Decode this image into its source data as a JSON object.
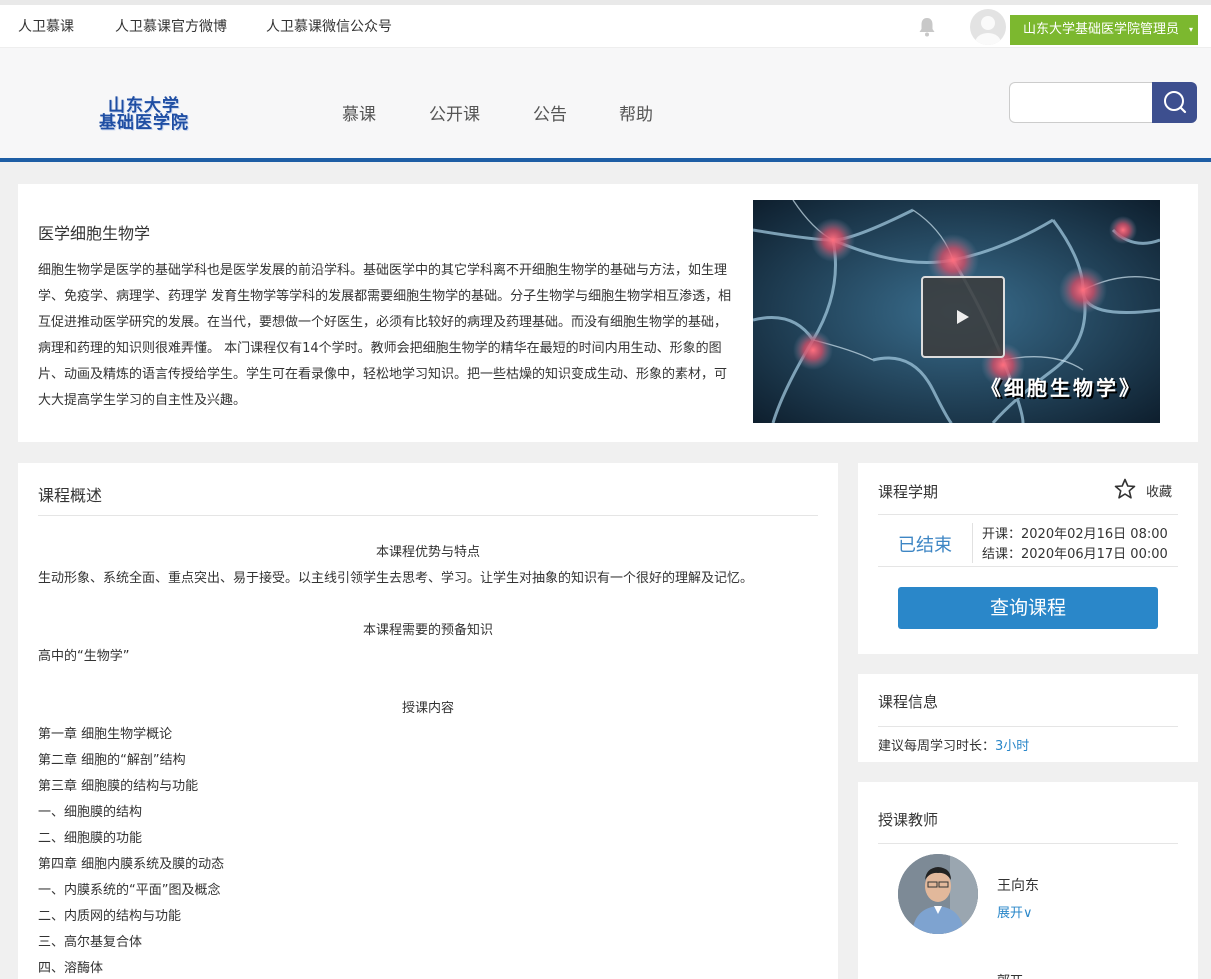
{
  "topbar": {
    "links": [
      "人卫慕课",
      "人卫慕课官方微博",
      "人卫慕课微信公众号"
    ],
    "user_label": "山东大学基础医学院管理员",
    "caret": "▾"
  },
  "header": {
    "logo_line1": "山东大学",
    "logo_line2": "基础医学院",
    "nav": [
      "慕课",
      "公开课",
      "公告",
      "帮助"
    ],
    "search_placeholder": ""
  },
  "course": {
    "title": "医学细胞生物学",
    "description": "细胞生物学是医学的基础学科也是医学发展的前沿学科。基础医学中的其它学科离不开细胞生物学的基础与方法，如生理学、免疫学、病理学、药理学 发育生物学等学科的发展都需要细胞生物学的基础。分子生物学与细胞生物学相互渗透，相互促进推动医学研究的发展。在当代，要想做一个好医生，必须有比较好的病理及药理基础。而没有细胞生物学的基础，病理和药理的知识则很难弄懂。 本门课程仅有14个学时。教师会把细胞生物学的精华在最短的时间内用生动、形象的图片、动画及精炼的语言传授给学生。学生可在看录像中，轻松地学习知识。把一些枯燥的知识变成生动、形象的素材，可大大提高学生学习的自主性及兴趣。",
    "video_caption": "《细胞生物学》"
  },
  "overview": {
    "title": "课程概述",
    "sec1_heading": "本课程优势与特点",
    "sec1_text": "生动形象、系统全面、重点突出、易于接受。以主线引领学生去思考、学习。让学生对抽象的知识有一个很好的理解及记忆。",
    "sec2_heading": "本课程需要的预备知识",
    "sec2_text": "高中的“生物学”",
    "sec3_heading": "授课内容",
    "chapters": [
      "第一章 细胞生物学概论",
      "第二章 细胞的“解剖”结构",
      "第三章 细胞膜的结构与功能",
      "一、细胞膜的结构",
      "二、细胞膜的功能",
      "第四章  细胞内膜系统及膜的动态",
      "一、内膜系统的“平面”图及概念",
      "二、内质网的结构与功能",
      "三、高尔基复合体",
      "四、溶酶体"
    ]
  },
  "term": {
    "title": "课程学期",
    "favorite": "收藏",
    "status": "已结束",
    "start": "开课：2020年02月16日 08:00",
    "end": "结课：2020年06月17日 00:00",
    "query_button": "查询课程"
  },
  "info": {
    "title": "课程信息",
    "weekly_label": "建议每周学习时长：",
    "weekly_value": "3小时"
  },
  "teachers": {
    "title": "授课教师",
    "name": "王向东",
    "expand": "展开∨",
    "next_partial": "郭兀"
  },
  "colors": {
    "accent_blue": "#2a87c9",
    "header_line": "#1e5ea5",
    "user_green": "#7cb82f",
    "search_btn": "#3d4f8f"
  }
}
